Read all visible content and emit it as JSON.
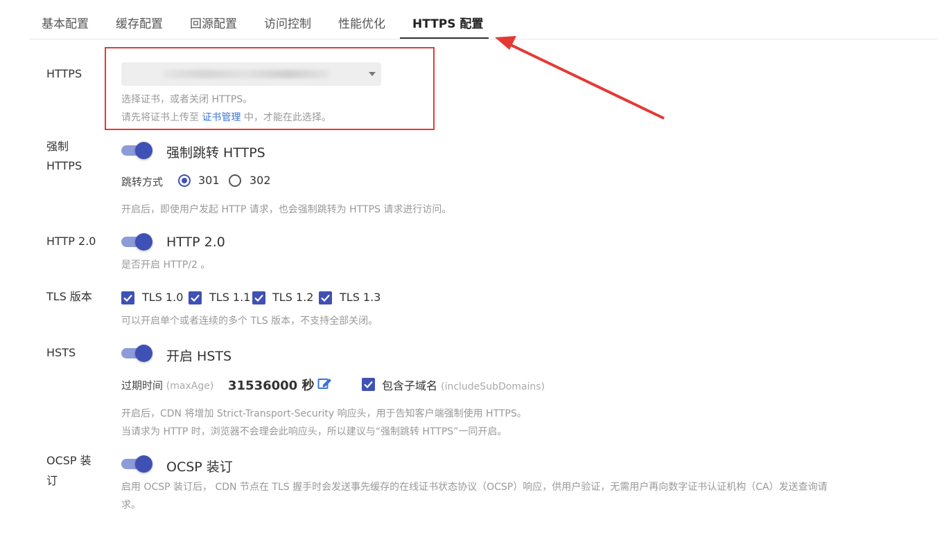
{
  "tabs": [
    {
      "label": "基本配置",
      "active": false
    },
    {
      "label": "缓存配置",
      "active": false
    },
    {
      "label": "回源配置",
      "active": false
    },
    {
      "label": "访问控制",
      "active": false
    },
    {
      "label": "性能优化",
      "active": false
    },
    {
      "label": "HTTPS 配置",
      "active": true
    }
  ],
  "https": {
    "label": "HTTPS",
    "help1": "选择证书，或者关闭 HTTPS。",
    "help2_prefix": "请先将证书上传至 ",
    "help2_link": "证书管理",
    "help2_suffix": " 中，才能在此选择。"
  },
  "force_https": {
    "label_line1": "强制",
    "label_line2": "HTTPS",
    "switch_label": "强制跳转 HTTPS",
    "switch_on": true,
    "redirect_label": "跳转方式",
    "options": [
      {
        "label": "301",
        "checked": true
      },
      {
        "label": "302",
        "checked": false
      }
    ],
    "help": "开启后，即使用户发起 HTTP 请求，也会强制跳转为 HTTPS 请求进行访问。"
  },
  "http2": {
    "label": "HTTP 2.0",
    "switch_label": "HTTP 2.0",
    "switch_on": true,
    "help": "是否开启 HTTP/2 。"
  },
  "tls": {
    "label": "TLS 版本",
    "versions": [
      {
        "label": "TLS 1.0",
        "checked": true
      },
      {
        "label": "TLS 1.1",
        "checked": true
      },
      {
        "label": "TLS 1.2",
        "checked": true
      },
      {
        "label": "TLS 1.3",
        "checked": true
      }
    ],
    "help": "可以开启单个或者连续的多个 TLS 版本，不支持全部关闭。"
  },
  "hsts": {
    "label": "HSTS",
    "switch_label": "开启 HSTS",
    "switch_on": true,
    "max_age_label": "过期时间",
    "max_age_hint": "(maxAge)",
    "max_age_value": "31536000 秒",
    "include_label": "包含子域名",
    "include_hint": "(includeSubDomains)",
    "include_checked": true,
    "help1": "开启后，CDN 将增加 Strict-Transport-Security 响应头，用于告知客户端强制使用 HTTPS。",
    "help2": "当请求为 HTTP 时，浏览器不会理会此响应头，所以建议与“强制跳转 HTTPS”一同开启。"
  },
  "ocsp": {
    "label_line1": "OCSP 装",
    "label_line2": "订",
    "switch_label": "OCSP 装订",
    "switch_on": true,
    "help1": "启用 OCSP 装订后， CDN 节点在 TLS 握手时会发送事先缓存的在线证书状态协议（OCSP）响应，供用户验证，无需用户再向数字证书认证机构（CA）发送查询请",
    "help2": "求。"
  },
  "colors": {
    "accent": "#3f51b5",
    "switch_track": "#8d9bd8",
    "link": "#3b73d6",
    "annotation": "#e53935"
  }
}
